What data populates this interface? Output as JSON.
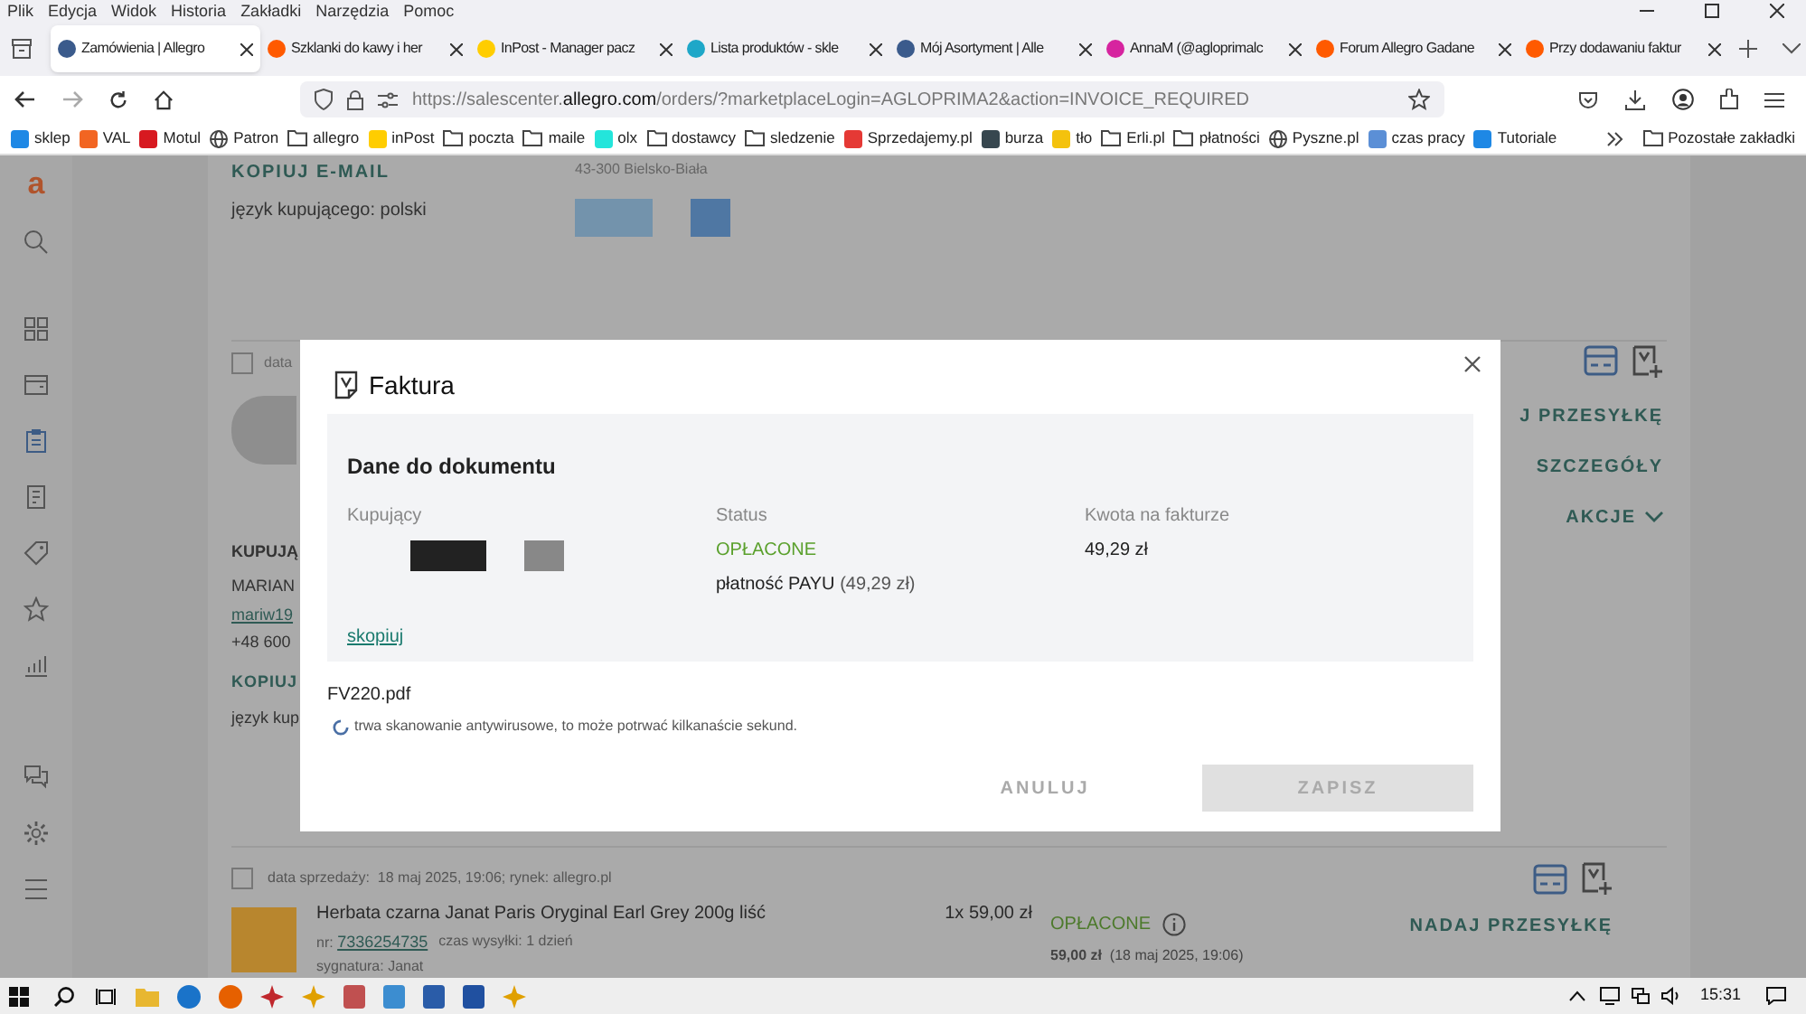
{
  "menu_bar": [
    "Plik",
    "Edycja",
    "Widok",
    "Historia",
    "Zakładki",
    "Narzędzia",
    "Pomoc"
  ],
  "tabs": [
    {
      "title": "Zamówienia | Allegro",
      "selected": true,
      "color": "#3b5b8c"
    },
    {
      "title": "Szklanki do kawy i her",
      "selected": false,
      "color": "#ff5a00"
    },
    {
      "title": "InPost - Manager pacz",
      "selected": false,
      "color": "#ffcd00"
    },
    {
      "title": "Lista produktów - skle",
      "selected": false,
      "color": "#1ea7c8"
    },
    {
      "title": "Mój Asortyment | Alle",
      "selected": false,
      "color": "#3b5b8c"
    },
    {
      "title": "AnnaM (@agloprimalc",
      "selected": false,
      "color": "#d6249f"
    },
    {
      "title": "Forum Allegro Gadane",
      "selected": false,
      "color": "#ff5a00"
    },
    {
      "title": "Przy dodawaniu faktur",
      "selected": false,
      "color": "#ff5a00"
    }
  ],
  "address_bar": {
    "url_prefix": "https://salescenter.",
    "url_domain": "allegro.com",
    "url_path": "/orders/?marketplaceLogin=AGLOPRIMA2&action=INVOICE_REQUIRED"
  },
  "bookmarks": [
    {
      "label": "sklep",
      "kind": "site",
      "color": "#1e88e5"
    },
    {
      "label": "VAL",
      "kind": "site",
      "color": "#f26522"
    },
    {
      "label": "Motul",
      "kind": "site",
      "color": "#d71920"
    },
    {
      "label": "Patron",
      "kind": "globe"
    },
    {
      "label": "allegro",
      "kind": "folder"
    },
    {
      "label": "inPost",
      "kind": "site",
      "color": "#ffcd00"
    },
    {
      "label": "poczta",
      "kind": "folder"
    },
    {
      "label": "maile",
      "kind": "folder"
    },
    {
      "label": "olx",
      "kind": "site",
      "color": "#23e5db"
    },
    {
      "label": "dostawcy",
      "kind": "folder"
    },
    {
      "label": "sledzenie",
      "kind": "folder"
    },
    {
      "label": "Sprzedajemy.pl",
      "kind": "site",
      "color": "#e53935"
    },
    {
      "label": "burza",
      "kind": "site",
      "color": "#37474f"
    },
    {
      "label": "tło",
      "kind": "site",
      "color": "#f4c20d"
    },
    {
      "label": "Erli.pl",
      "kind": "folder"
    },
    {
      "label": "płatności",
      "kind": "folder"
    },
    {
      "label": "Pyszne.pl",
      "kind": "globe"
    },
    {
      "label": "czas pracy",
      "kind": "site",
      "color": "#5b8fd6"
    },
    {
      "label": "Tutoriale",
      "kind": "site",
      "color": "#1e88e5"
    }
  ],
  "other_bookmarks": "Pozostałe zakładki",
  "side_rail": {
    "logo": "a",
    "top_items": [
      {
        "kind": "search",
        "selected": false
      },
      {
        "kind": "grid",
        "selected": false
      },
      {
        "kind": "wallet",
        "selected": false
      },
      {
        "kind": "clipboard",
        "selected": true
      },
      {
        "kind": "document",
        "selected": false
      },
      {
        "kind": "tag",
        "selected": false
      },
      {
        "kind": "star",
        "selected": false
      },
      {
        "kind": "chart",
        "selected": false
      }
    ],
    "bottom_items": [
      {
        "kind": "chat",
        "selected": false
      },
      {
        "kind": "gear",
        "selected": false
      },
      {
        "kind": "list",
        "selected": false
      }
    ]
  },
  "previous_order": {
    "copy_email": "KOPIUJ E-MAIL",
    "buyer_language": "język kupującego: polski",
    "address": "43-300 Bielsko-Biała"
  },
  "current_order": {
    "checked": false,
    "date": "data",
    "buyer_heading": "KUPUJĄ",
    "buyer_name": "MARIAN",
    "buyer_email": "mariw19",
    "buyer_phone": "+48 600",
    "copy": "KOPIUJ",
    "buyer_language": "język kup",
    "ship_action": "J PRZESYŁKĘ",
    "details_action": "SZCZEGÓŁY",
    "actions_menu": "AKCJE"
  },
  "next_order": {
    "checked": false,
    "date_label": "data sprzedaży:",
    "date": "18 maj 2025, 19:06; rynek: allegro.pl",
    "product": "Herbata czarna Janat Paris Oryginal Earl Grey 200g liść",
    "number_label": "nr:",
    "number": "7336254735",
    "shipping_time": "czas wysyłki: 1 dzień",
    "signature": "sygnatura: Janat",
    "quantity_price": "1x 59,00 zł",
    "status": "OPŁACONE",
    "paid_amount": "59,00 zł",
    "paid_date": "(18 maj 2025, 19:06)",
    "ship_action": "NADAJ PRZESYŁKĘ"
  },
  "dialog": {
    "title": "Faktura",
    "section_title": "Dane do dokumentu",
    "columns": [
      {
        "label": "Kupujący",
        "kind": "redacted"
      },
      {
        "label": "Status",
        "kind": "status",
        "status": "OPŁACONE",
        "payment": "płatność PAYU",
        "payment_amount": "(49,29 zł)"
      },
      {
        "label": "Kwota na fakturze",
        "kind": "amount",
        "amount": "49,29 zł"
      }
    ],
    "copy_link": "skopiuj",
    "file_name": "FV220.pdf",
    "scan_message": "trwa skanowanie antywirusowe, to może potrwać kilkanaście sekund.",
    "buttons": [
      {
        "label": "ANULUJ",
        "kind": "text",
        "disabled": true
      },
      {
        "label": "ZAPISZ",
        "kind": "filled",
        "disabled": true
      }
    ]
  },
  "taskbar": {
    "apps": [
      {
        "kind": "folder",
        "color": "#e8b731"
      },
      {
        "kind": "circle",
        "color": "#1a73c9"
      },
      {
        "kind": "circle",
        "color": "#e66000"
      },
      {
        "kind": "sun",
        "color": "#c0282d"
      },
      {
        "kind": "sun",
        "color": "#e0a000"
      },
      {
        "kind": "tile",
        "color": "#c05050"
      },
      {
        "kind": "tile",
        "color": "#3c8dd0"
      },
      {
        "kind": "tile",
        "color": "#2a5ca8"
      },
      {
        "kind": "tile",
        "color": "#2050a0"
      },
      {
        "kind": "sun",
        "color": "#e0a000"
      }
    ],
    "clock": "15:31"
  }
}
